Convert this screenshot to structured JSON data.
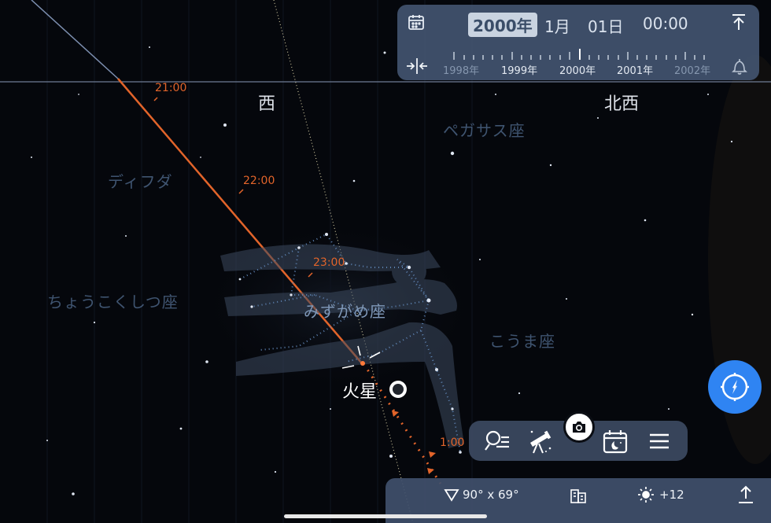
{
  "horizon_labels": {
    "west": "西",
    "northwest": "北西"
  },
  "constellations": {
    "pegasus": "ペガサス座",
    "diphda": "ディフダ",
    "sculptor": "ちょうこくしつ座",
    "aquarius": "みずがめ座",
    "equuleus": "こうま座"
  },
  "track_times": {
    "t2100": "21:00",
    "t2200": "22:00",
    "t2300": "23:00",
    "t0100": "1:00"
  },
  "planet": {
    "name": "火星"
  },
  "date_panel": {
    "year": "2000年",
    "month": "1月",
    "day": "01日",
    "time": "00:00",
    "scale": [
      "1998年",
      "1999年",
      "2000年",
      "2001年",
      "2002年"
    ]
  },
  "bottom_bar": {
    "fov": "90° x 69°",
    "brightness": "+12"
  },
  "colors": {
    "track": "#e2642a",
    "accent": "#2f84f2",
    "panel": "#465874"
  },
  "icons": {
    "date": "calendar-icon",
    "collapse": "collapse-arrows-icon",
    "jump_top": "arrow-up-bar-icon",
    "alarm": "bell-icon",
    "compass": "compass-icon",
    "search": "search-list-icon",
    "telescope": "telescope-icon",
    "camera": "camera-icon",
    "calendar_night": "calendar-moon-icon",
    "menu": "menu-icon",
    "fov": "fov-triangle-icon",
    "buildings": "buildings-icon",
    "sun": "sun-icon",
    "share": "share-icon"
  }
}
